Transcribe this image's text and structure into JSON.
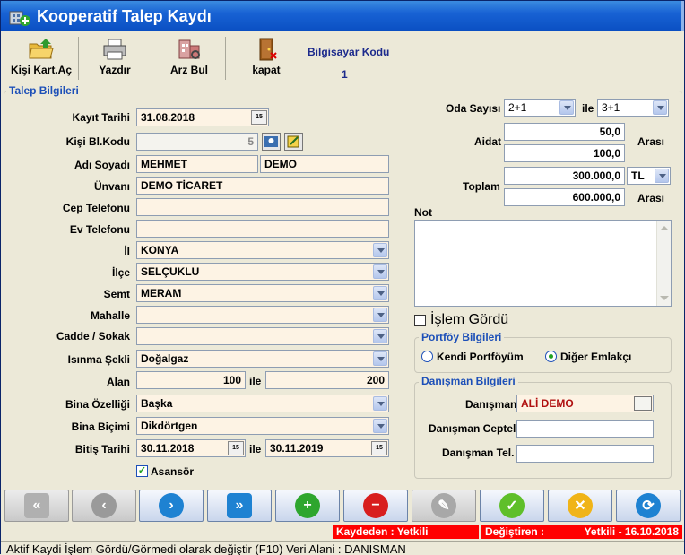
{
  "window": {
    "title": "Kooperatif Talep Kaydı"
  },
  "toolbar": {
    "open_card": "Kişi Kart.Aç",
    "print": "Yazdır",
    "find": "Arz Bul",
    "close": "kapat",
    "computer_code_label": "Bilgisayar Kodu",
    "computer_code_value": "1"
  },
  "talep": {
    "group_title": "Talep Bilgileri",
    "kayit_tarihi_label": "Kayıt Tarihi",
    "kayit_tarihi": "31.08.2018",
    "kisi_kodu_label": "Kişi Bl.Kodu",
    "kisi_kodu": "5",
    "adi_soyadi_label": "Adı Soyadı",
    "adi": "MEHMET",
    "soyadi": "DEMO",
    "unvani_label": "Ünvanı",
    "unvani": "DEMO TİCARET",
    "cep_label": "Cep Telefonu",
    "cep": "",
    "ev_label": "Ev Telefonu",
    "ev": "",
    "il_label": "İl",
    "il": "KONYA",
    "ilce_label": "İlçe",
    "ilce": "SELÇUKLU",
    "semt_label": "Semt",
    "semt": "MERAM",
    "mahalle_label": "Mahalle",
    "mahalle": "",
    "cadde_label": "Cadde / Sokak",
    "cadde": "",
    "isinma_label": "Isınma Şekli",
    "isinma": "Doğalgaz",
    "alan_label": "Alan",
    "alan_min": "100",
    "ile": "ile",
    "alan_max": "200",
    "bina_ozellik_label": "Bina Özelliği",
    "bina_ozellik": "Başka",
    "bina_bicim_label": "Bina Biçimi",
    "bina_bicim": "Dikdörtgen",
    "bitis_label": "Bitiş Tarihi",
    "bitis_min": "30.11.2018",
    "bitis_max": "30.11.2019",
    "asansor_label": "Asansör",
    "asansor_checked": true
  },
  "right": {
    "oda_label": "Oda Sayısı",
    "oda_min": "2+1",
    "oda_ile": "ile",
    "oda_max": "3+1",
    "aidat_label": "Aidat",
    "aidat_min": "50,0",
    "aidat_max": "100,0",
    "arasi": "Arası",
    "toplam_label": "Toplam",
    "toplam_min": "300.000,0",
    "toplam_max": "600.000,0",
    "currency": "TL",
    "not_label": "Not",
    "islem_gordu_label": "İşlem Gördü"
  },
  "portfoy": {
    "title": "Portföy Bilgileri",
    "kendi": "Kendi Portföyüm",
    "diger": "Diğer Emlakçı",
    "selected": "diger"
  },
  "danisman": {
    "title": "Danışman Bilgileri",
    "danisman_label": "Danışman",
    "danisman": "ALİ DEMO",
    "ceptel_label": "Danışman Ceptel",
    "ceptel": "",
    "tel_label": "Danışman Tel.",
    "tel": ""
  },
  "status": {
    "kaydeden": "Kaydeden : Yetkili",
    "degistiren_label": "Değiştiren :",
    "degistiren_value": "Yetkili - 16.10.2018",
    "bottom": "Aktif Kaydi İşlem Gördü/Görmedi olarak değiştir (F10) Veri Alani : DANISMAN"
  },
  "colors": {
    "status_red": "#ff0000",
    "accent_blue": "#1c4fb8"
  }
}
